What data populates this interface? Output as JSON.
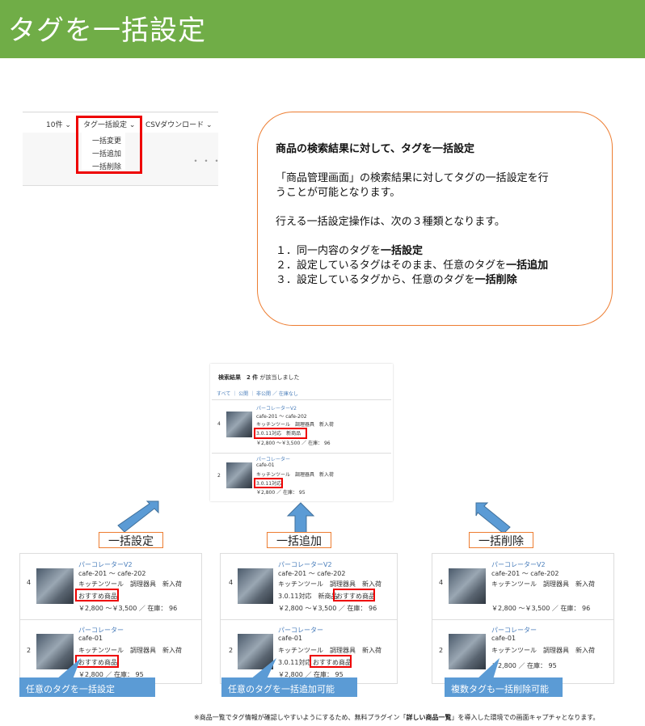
{
  "header": {
    "title": "タグを一括設定"
  },
  "toolbar": {
    "count": "10件",
    "bulk_tag": "タグ一括設定",
    "csv": "CSVダウンロード",
    "menu": [
      "一括変更",
      "一括追加",
      "一括削除"
    ],
    "more": "・・・"
  },
  "bubble": {
    "heading": "商品の検索結果に対して、タグを一括設定",
    "line1": "「商品管理画面」の検索結果に対してタグの一括設定を行",
    "line2": "うことが可能となります。",
    "line3": "行える一括設定操作は、次の３種類となります。",
    "item1_pre": "１．同一内容のタグを",
    "item1_bold": "一括設定",
    "item2_pre": "２．設定しているタグはそのまま、任意のタグを",
    "item2_bold": "一括追加",
    "item3_pre": "３．設定しているタグから、任意のタグを",
    "item3_bold": "一括削除"
  },
  "result": {
    "label": "検索結果",
    "count": "2 件",
    "found": "が該当しました",
    "filters": [
      "すべて",
      "公開",
      "非公開",
      "在庫なし"
    ],
    "items": [
      {
        "stock": "4",
        "name": "パーコレーターV2",
        "code": "cafe-201 ～ cafe-202",
        "cats": "キッチンツール　調理器具　新入荷",
        "tags": "3.0.11対応　新商品",
        "price": "￥2,800 ～￥3,500 ／ 在庫： 96"
      },
      {
        "stock": "2",
        "name": "パーコレーター",
        "code": "cafe-01",
        "cats": "キッチンツール　調理器具　新入荷",
        "tags": "3.0.11対応",
        "price": "￥2,800 ／ 在庫： 95"
      }
    ]
  },
  "labels": {
    "set": "一括設定",
    "add": "一括追加",
    "del": "一括削除"
  },
  "panels": {
    "set": {
      "tag1": "おすすめ商品",
      "tag2": "おすすめ商品",
      "callout": "任意のタグを一括設定"
    },
    "add": {
      "tag1_pre": "3.0.11対応　新商品",
      "tag1": "おすすめ商品",
      "tag2_pre": "3.0.11対応",
      "tag2": "おすすめ商品",
      "callout": "任意のタグを一括追加可能"
    },
    "del": {
      "callout": "複数タグも一括削除可能"
    }
  },
  "footnote": {
    "pre": "※商品一覧でタグ情報が確認しやすいようにするため、無料プラグイン「",
    "bold": "詳しい商品一覧",
    "post": "」を導入した環境での画面キャプチャとなります。"
  },
  "colors": {
    "header": "#70ad47",
    "accent": "#ed7d31",
    "callout": "#5b9bd5",
    "highlight": "#e00000",
    "arrow": "#5b9bd5"
  }
}
